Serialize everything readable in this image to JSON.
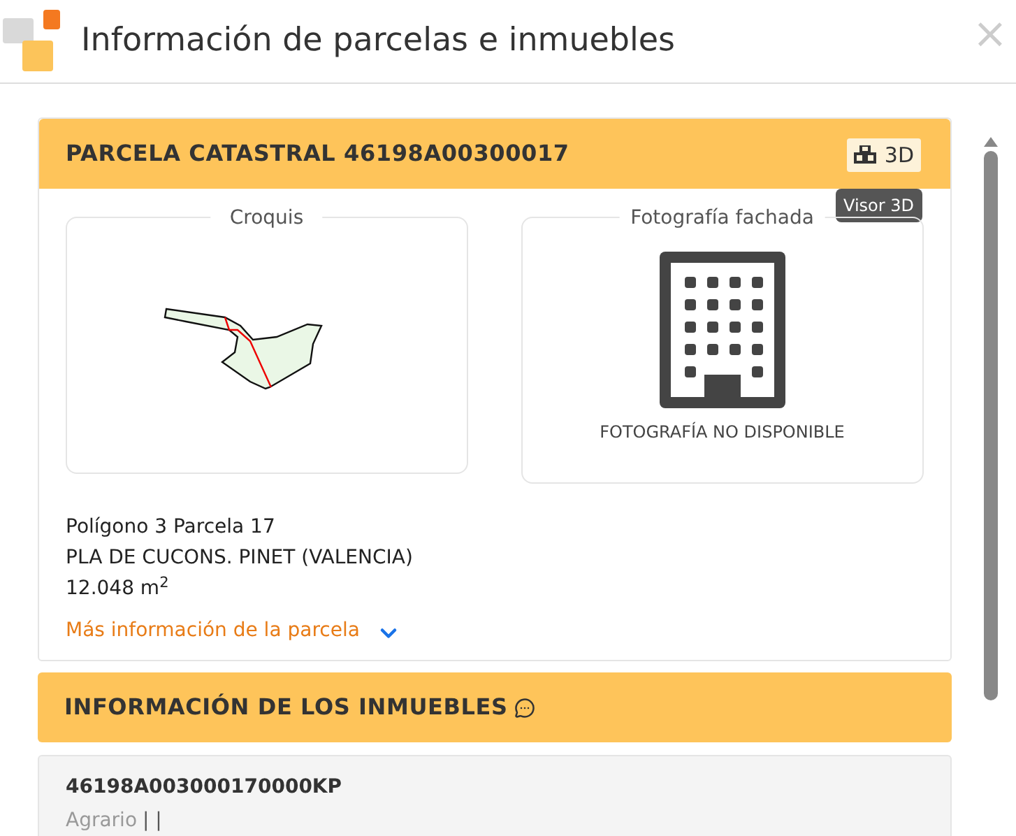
{
  "window": {
    "title": "Información de parcelas e inmuebles",
    "close": "×"
  },
  "parcel": {
    "title": "PARCELA CATASTRAL 46198A00300017",
    "view3d": {
      "label": "3D",
      "tooltip": "Visor 3D"
    },
    "sketch": {
      "title": "Croquis"
    },
    "photo": {
      "title": "Fotografía fachada",
      "caption": "FOTOGRAFÍA NO DISPONIBLE"
    },
    "lines": [
      "Polígono 3 Parcela 17",
      "PLA DE CUCONS. PINET (VALENCIA)",
      "12.048 m$^{2}$"
    ],
    "more": {
      "label": "Más información de la parcela",
      "expanded": false
    }
  },
  "properties": {
    "title": "INFORMACIÓN DE LOS INMUEBLES",
    "items": [
      {
        "reference": "46198A003000170000KP",
        "use": "Agrario",
        "separators": "| |"
      }
    ]
  }
}
